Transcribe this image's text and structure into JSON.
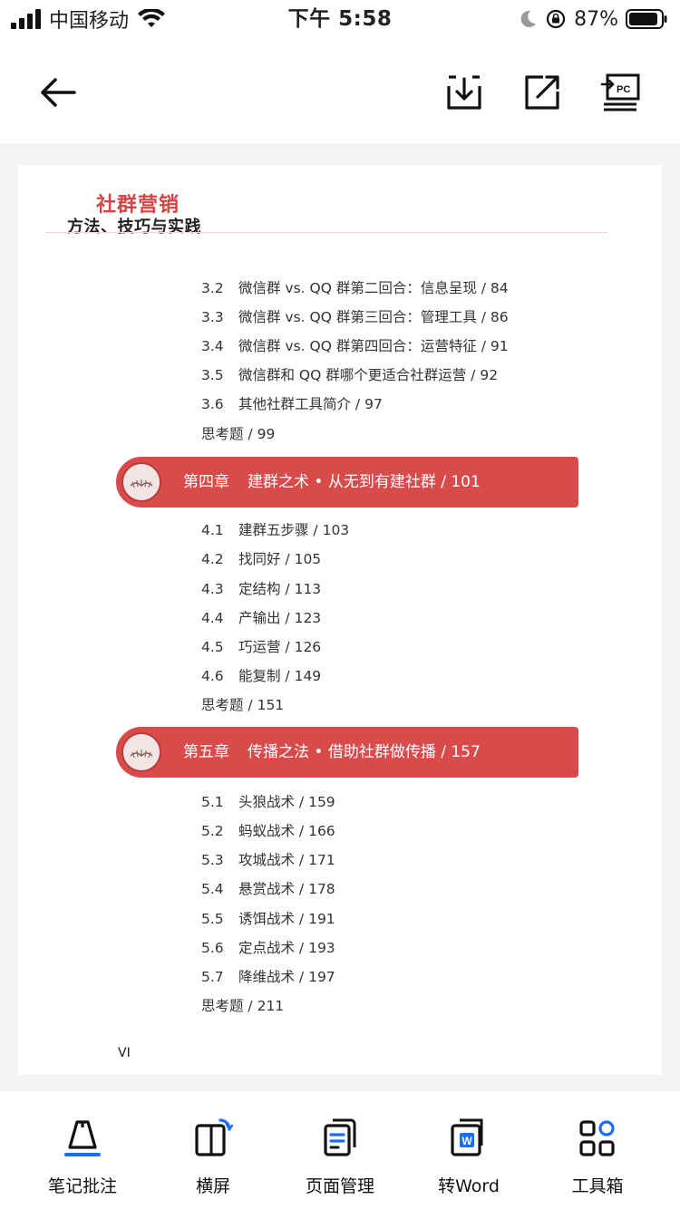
{
  "status": {
    "carrier": "中国移动",
    "time": "下午 5:58",
    "battery": "87%"
  },
  "book": {
    "title": "社群营销",
    "subtitle": "方法、技巧与实践"
  },
  "toc": {
    "group1": [
      {
        "num": "3.2",
        "text": "微信群 vs. QQ 群第二回合：信息呈现 / 84"
      },
      {
        "num": "3.3",
        "text": "微信群 vs. QQ 群第三回合：管理工具 / 86"
      },
      {
        "num": "3.4",
        "text": "微信群 vs. QQ 群第四回合：运营特征 / 91"
      },
      {
        "num": "3.5",
        "text": "微信群和 QQ 群哪个更适合社群运营 / 92"
      },
      {
        "num": "3.6",
        "text": "其他社群工具简介 / 97"
      },
      {
        "num": "",
        "text": "思考题 / 99"
      }
    ],
    "chapter4": {
      "label": "第四章",
      "title": "建群之术 • 从无到有建社群 / 101"
    },
    "group2": [
      {
        "num": "4.1",
        "text": "建群五步骤 / 103"
      },
      {
        "num": "4.2",
        "text": "找同好 / 105"
      },
      {
        "num": "4.3",
        "text": "定结构 / 113"
      },
      {
        "num": "4.4",
        "text": "产输出 / 123"
      },
      {
        "num": "4.5",
        "text": "巧运营 / 126"
      },
      {
        "num": "4.6",
        "text": "能复制 / 149"
      },
      {
        "num": "",
        "text": "思考题 / 151"
      }
    ],
    "chapter5": {
      "label": "第五章",
      "title": "传播之法 • 借助社群做传播 / 157"
    },
    "group3": [
      {
        "num": "5.1",
        "text": "头狼战术 / 159"
      },
      {
        "num": "5.2",
        "text": "蚂蚁战术 / 166"
      },
      {
        "num": "5.3",
        "text": "攻城战术 / 171"
      },
      {
        "num": "5.4",
        "text": "悬赏战术 / 178"
      },
      {
        "num": "5.5",
        "text": "诱饵战术 / 191"
      },
      {
        "num": "5.6",
        "text": "定点战术 / 193"
      },
      {
        "num": "5.7",
        "text": "降维战术 / 197"
      },
      {
        "num": "",
        "text": "思考题 / 211"
      }
    ],
    "page_number": "VI"
  },
  "bottom_bar": {
    "items": [
      {
        "label": "笔记批注",
        "icon": "pen-icon"
      },
      {
        "label": "横屏",
        "icon": "rotate-icon"
      },
      {
        "label": "页面管理",
        "icon": "pages-icon"
      },
      {
        "label": "转Word",
        "icon": "word-icon"
      },
      {
        "label": "工具箱",
        "icon": "grid-icon"
      }
    ]
  },
  "colors": {
    "accent_red": "#d94b4b",
    "title_red": "#d64544",
    "icon_blue": "#1a6dff"
  }
}
